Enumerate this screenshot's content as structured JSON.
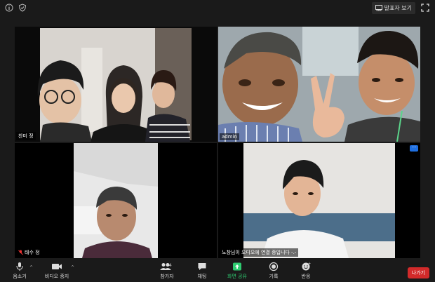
{
  "topbar": {
    "speaker_view_label": "발표자 보기"
  },
  "tiles": [
    {
      "name": "찬미 정",
      "active": true
    },
    {
      "name": "admin"
    },
    {
      "name": "태수 정",
      "muted": true
    },
    {
      "name": "노창님이 오디오에 연결 중입니다 -.-"
    }
  ],
  "toolbar": {
    "audio_label": "음소거",
    "video_label": "비디오 중지",
    "participants_label": "참가자",
    "participants_count": "4",
    "chat_label": "채팅",
    "share_label": "화면 공유",
    "record_label": "기록",
    "reactions_label": "반응",
    "leave_label": "나가기"
  },
  "colors": {
    "active_speaker_border": "#e6e36b",
    "share_green": "#2ecc71",
    "leave_red": "#d22a2a",
    "accent_blue": "#1f6fe0"
  }
}
